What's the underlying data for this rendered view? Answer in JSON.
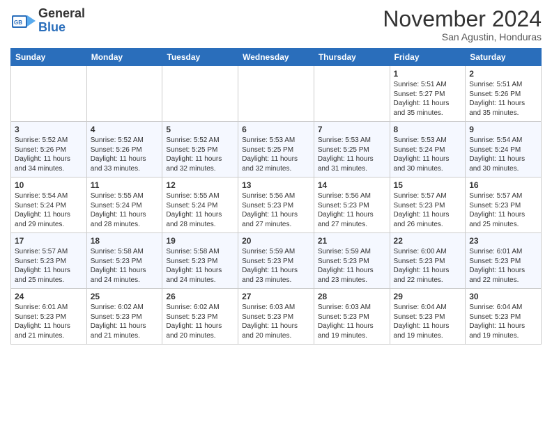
{
  "logo": {
    "general": "General",
    "blue": "Blue"
  },
  "header": {
    "month": "November 2024",
    "location": "San Agustin, Honduras"
  },
  "weekdays": [
    "Sunday",
    "Monday",
    "Tuesday",
    "Wednesday",
    "Thursday",
    "Friday",
    "Saturday"
  ],
  "weeks": [
    [
      {
        "day": "",
        "info": ""
      },
      {
        "day": "",
        "info": ""
      },
      {
        "day": "",
        "info": ""
      },
      {
        "day": "",
        "info": ""
      },
      {
        "day": "",
        "info": ""
      },
      {
        "day": "1",
        "info": "Sunrise: 5:51 AM\nSunset: 5:27 PM\nDaylight: 11 hours\nand 35 minutes."
      },
      {
        "day": "2",
        "info": "Sunrise: 5:51 AM\nSunset: 5:26 PM\nDaylight: 11 hours\nand 35 minutes."
      }
    ],
    [
      {
        "day": "3",
        "info": "Sunrise: 5:52 AM\nSunset: 5:26 PM\nDaylight: 11 hours\nand 34 minutes."
      },
      {
        "day": "4",
        "info": "Sunrise: 5:52 AM\nSunset: 5:26 PM\nDaylight: 11 hours\nand 33 minutes."
      },
      {
        "day": "5",
        "info": "Sunrise: 5:52 AM\nSunset: 5:25 PM\nDaylight: 11 hours\nand 32 minutes."
      },
      {
        "day": "6",
        "info": "Sunrise: 5:53 AM\nSunset: 5:25 PM\nDaylight: 11 hours\nand 32 minutes."
      },
      {
        "day": "7",
        "info": "Sunrise: 5:53 AM\nSunset: 5:25 PM\nDaylight: 11 hours\nand 31 minutes."
      },
      {
        "day": "8",
        "info": "Sunrise: 5:53 AM\nSunset: 5:24 PM\nDaylight: 11 hours\nand 30 minutes."
      },
      {
        "day": "9",
        "info": "Sunrise: 5:54 AM\nSunset: 5:24 PM\nDaylight: 11 hours\nand 30 minutes."
      }
    ],
    [
      {
        "day": "10",
        "info": "Sunrise: 5:54 AM\nSunset: 5:24 PM\nDaylight: 11 hours\nand 29 minutes."
      },
      {
        "day": "11",
        "info": "Sunrise: 5:55 AM\nSunset: 5:24 PM\nDaylight: 11 hours\nand 28 minutes."
      },
      {
        "day": "12",
        "info": "Sunrise: 5:55 AM\nSunset: 5:24 PM\nDaylight: 11 hours\nand 28 minutes."
      },
      {
        "day": "13",
        "info": "Sunrise: 5:56 AM\nSunset: 5:23 PM\nDaylight: 11 hours\nand 27 minutes."
      },
      {
        "day": "14",
        "info": "Sunrise: 5:56 AM\nSunset: 5:23 PM\nDaylight: 11 hours\nand 27 minutes."
      },
      {
        "day": "15",
        "info": "Sunrise: 5:57 AM\nSunset: 5:23 PM\nDaylight: 11 hours\nand 26 minutes."
      },
      {
        "day": "16",
        "info": "Sunrise: 5:57 AM\nSunset: 5:23 PM\nDaylight: 11 hours\nand 25 minutes."
      }
    ],
    [
      {
        "day": "17",
        "info": "Sunrise: 5:57 AM\nSunset: 5:23 PM\nDaylight: 11 hours\nand 25 minutes."
      },
      {
        "day": "18",
        "info": "Sunrise: 5:58 AM\nSunset: 5:23 PM\nDaylight: 11 hours\nand 24 minutes."
      },
      {
        "day": "19",
        "info": "Sunrise: 5:58 AM\nSunset: 5:23 PM\nDaylight: 11 hours\nand 24 minutes."
      },
      {
        "day": "20",
        "info": "Sunrise: 5:59 AM\nSunset: 5:23 PM\nDaylight: 11 hours\nand 23 minutes."
      },
      {
        "day": "21",
        "info": "Sunrise: 5:59 AM\nSunset: 5:23 PM\nDaylight: 11 hours\nand 23 minutes."
      },
      {
        "day": "22",
        "info": "Sunrise: 6:00 AM\nSunset: 5:23 PM\nDaylight: 11 hours\nand 22 minutes."
      },
      {
        "day": "23",
        "info": "Sunrise: 6:01 AM\nSunset: 5:23 PM\nDaylight: 11 hours\nand 22 minutes."
      }
    ],
    [
      {
        "day": "24",
        "info": "Sunrise: 6:01 AM\nSunset: 5:23 PM\nDaylight: 11 hours\nand 21 minutes."
      },
      {
        "day": "25",
        "info": "Sunrise: 6:02 AM\nSunset: 5:23 PM\nDaylight: 11 hours\nand 21 minutes."
      },
      {
        "day": "26",
        "info": "Sunrise: 6:02 AM\nSunset: 5:23 PM\nDaylight: 11 hours\nand 20 minutes."
      },
      {
        "day": "27",
        "info": "Sunrise: 6:03 AM\nSunset: 5:23 PM\nDaylight: 11 hours\nand 20 minutes."
      },
      {
        "day": "28",
        "info": "Sunrise: 6:03 AM\nSunset: 5:23 PM\nDaylight: 11 hours\nand 19 minutes."
      },
      {
        "day": "29",
        "info": "Sunrise: 6:04 AM\nSunset: 5:23 PM\nDaylight: 11 hours\nand 19 minutes."
      },
      {
        "day": "30",
        "info": "Sunrise: 6:04 AM\nSunset: 5:23 PM\nDaylight: 11 hours\nand 19 minutes."
      }
    ]
  ]
}
